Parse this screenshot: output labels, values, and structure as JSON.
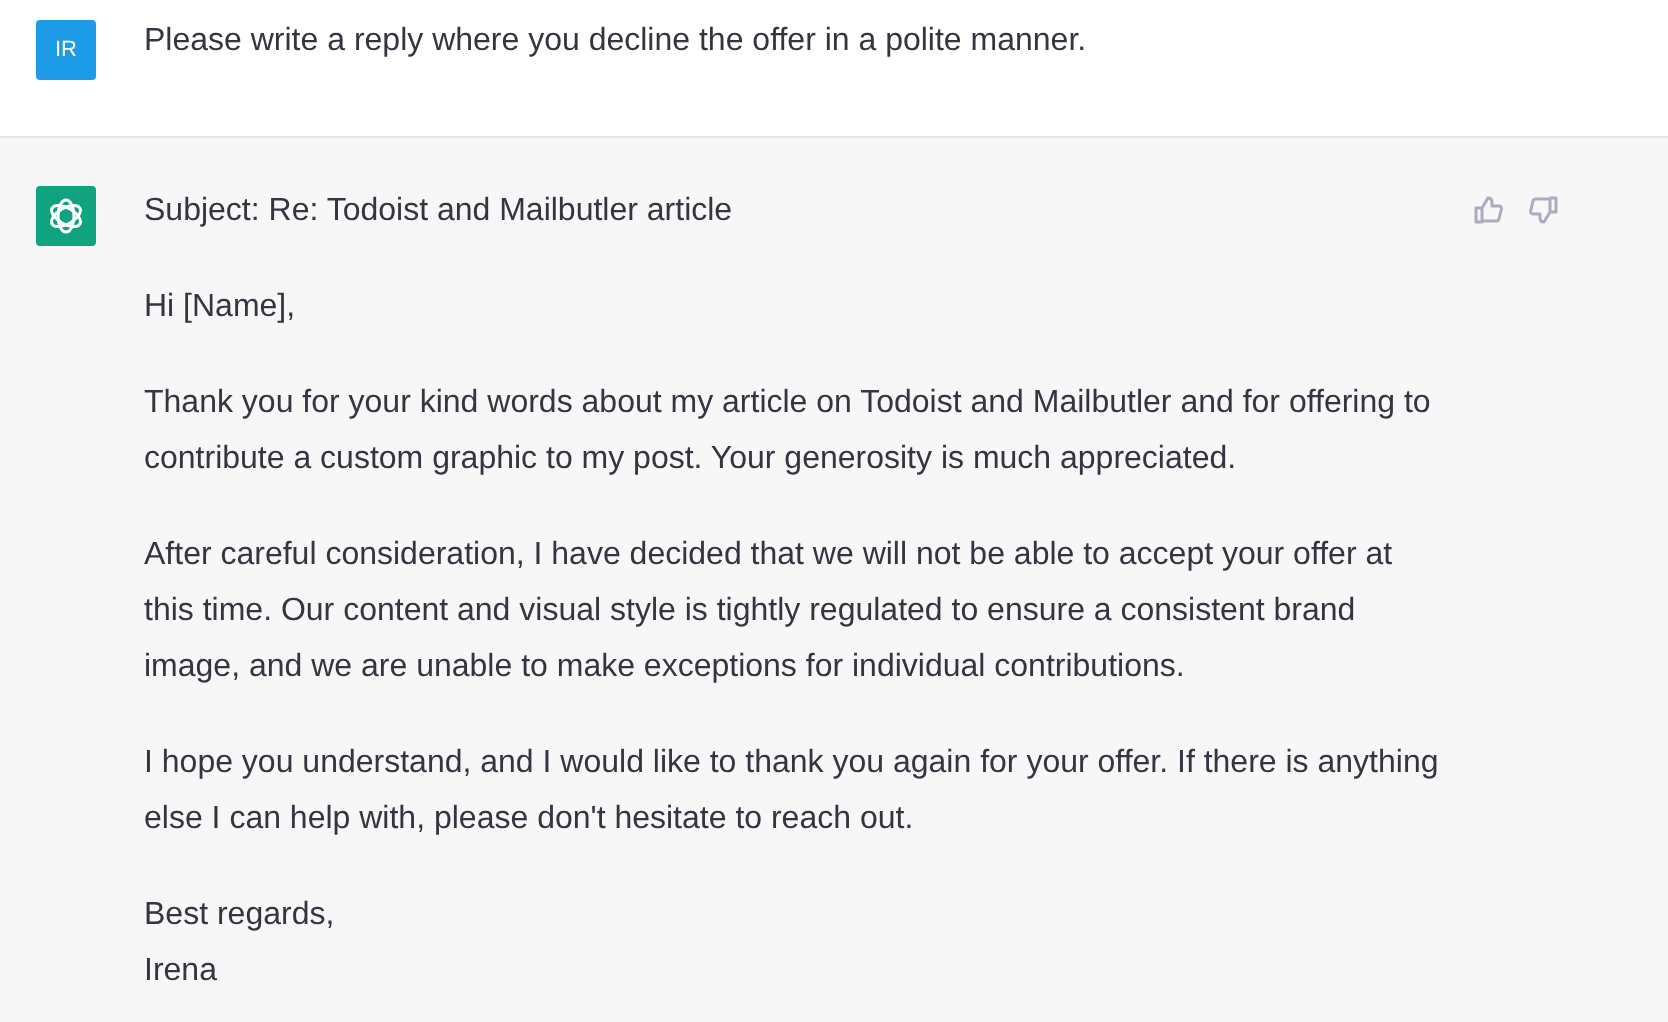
{
  "user_message": {
    "avatar": "IR",
    "text": "Please write a reply where you decline the offer in a polite manner."
  },
  "assistant_message": {
    "paragraphs": [
      [
        "Subject: Re: Todoist and Mailbutler article"
      ],
      [
        "Hi [Name],"
      ],
      [
        "Thank you for your kind words about my article on Todoist and Mailbutler and for offering to contribute a custom graphic to my post. Your generosity is much appreciated."
      ],
      [
        "After careful consideration, I have decided that we will not be able to accept your offer at this time. Our content and visual style is tightly regulated to ensure a consistent brand image, and we are unable to make exceptions for individual contributions."
      ],
      [
        "I hope you understand, and I would like to thank you again for your offer. If there is anything else I can help with, please don't hesitate to reach out."
      ],
      [
        "Best regards,",
        "Irena"
      ]
    ]
  }
}
